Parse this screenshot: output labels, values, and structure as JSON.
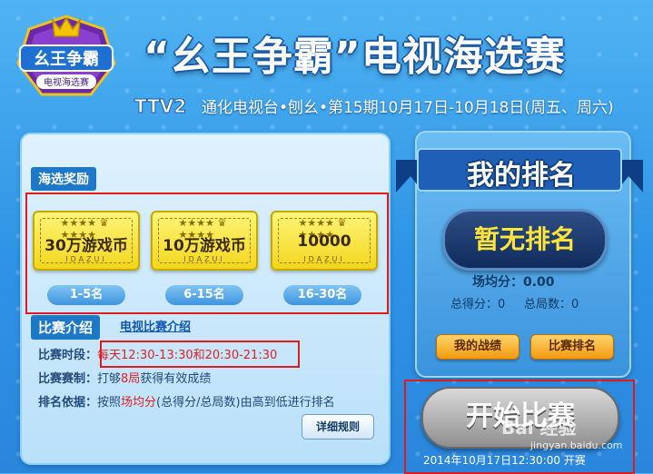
{
  "header": {
    "logo_text": "幺王争霸",
    "logo_sub": "电视海选赛",
    "title": "“幺王争霸”电视海选赛",
    "ttv_logo": "TTV2",
    "subtitle": "通化电视台•刨幺•第15期10月17日-10月18日(周五、周六)"
  },
  "prizes": {
    "heading": "海选奖励",
    "items": [
      {
        "amount": "30万游戏币",
        "brand": "IDAZUI",
        "rank": "1-5名"
      },
      {
        "amount": "10万游戏币",
        "brand": "IDAZUI",
        "rank": "6-15名"
      },
      {
        "amount": "10000",
        "brand": "IDAZUI",
        "rank": "16-30名"
      }
    ]
  },
  "intro": {
    "heading": "比赛介绍",
    "tv_link": "电视比赛介绍",
    "time_label": "比赛时段：",
    "time_value": "每天12:30-13:30和20:30-21:30",
    "rule_label": "比赛赛制：",
    "rule_pre": "打够",
    "rule_num": "8局",
    "rule_post": "获得有效成绩",
    "basis_label": "排名依据：",
    "basis_pre": "按照",
    "basis_key": "场均分",
    "basis_post": "(总得分/总局数)由高到低进行排名",
    "detail_button": "详细规则"
  },
  "ranking": {
    "title": "我的排名",
    "status": "暂无排名",
    "avg_label": "场均分：",
    "avg_value": "0.00",
    "total_score_label": "总得分：",
    "total_score": "0",
    "total_games_label": "总局数：",
    "total_games": "0",
    "record_button": "我的战绩",
    "match_rank_button": "比赛排名"
  },
  "start": {
    "button": "开始比赛",
    "time": "2014年10月17日12:30:00 开赛",
    "watermark": "Bai 经验",
    "watermark_url": "jingyan.baidu.com"
  },
  "colors": {
    "background": "#2f93e6",
    "highlight_box": "#e01b1b",
    "coin": "#f2d61c",
    "rank_badge_text": "#ffe43a"
  }
}
